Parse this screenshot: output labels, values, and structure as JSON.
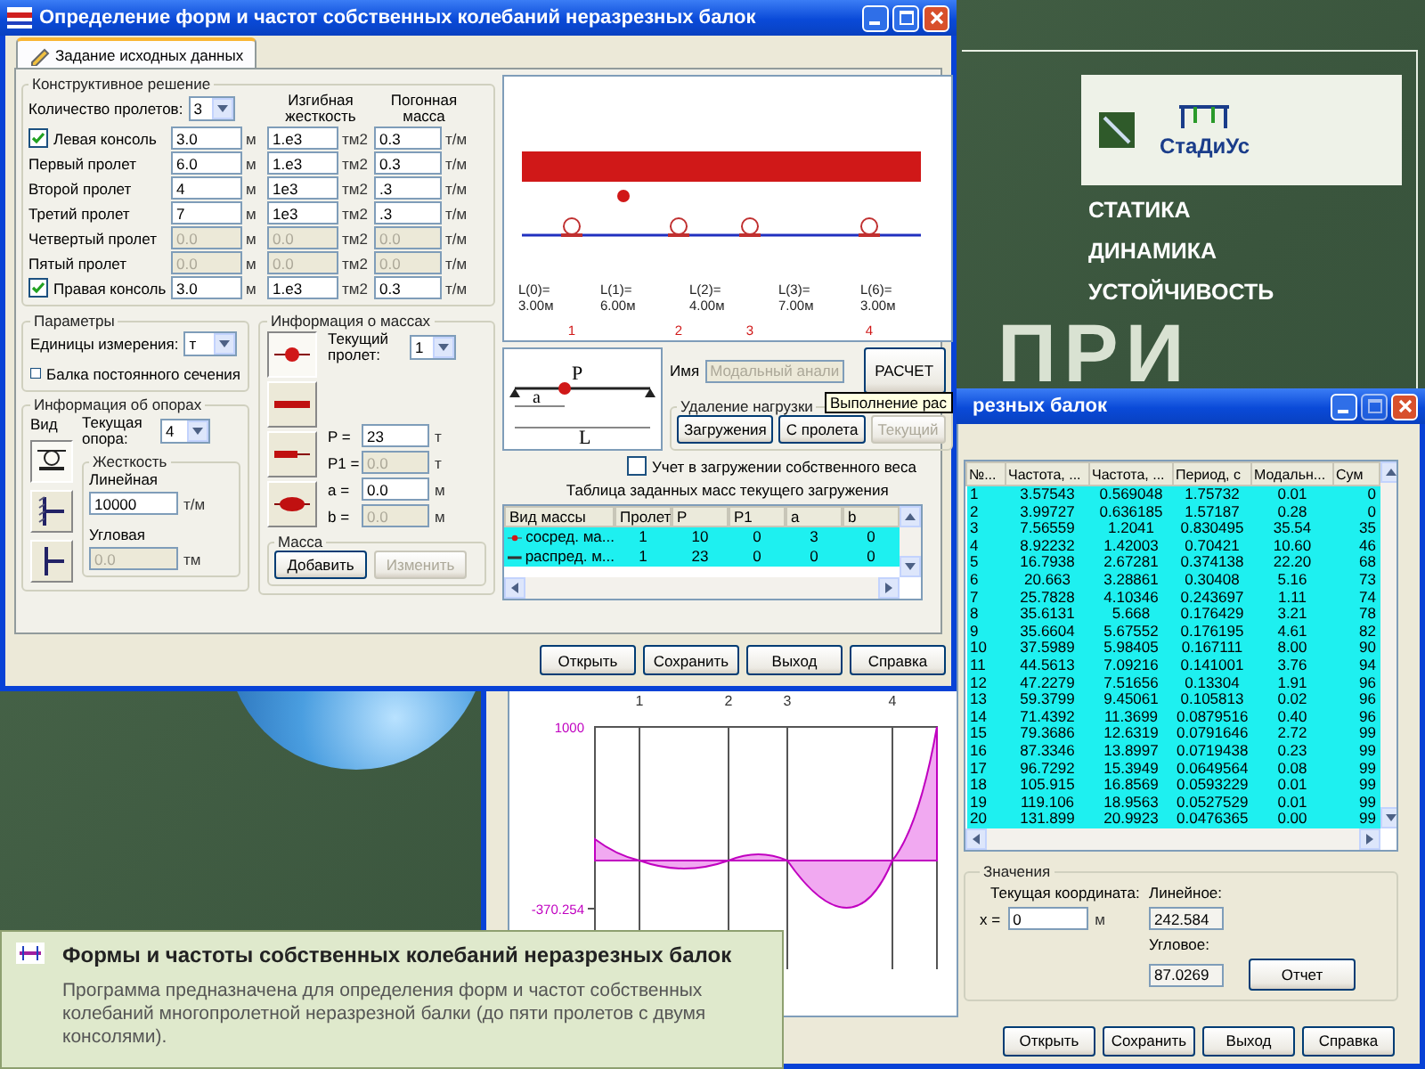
{
  "slide": {
    "background_text": "ПРИ",
    "logo": {
      "name": "СтаДиУс"
    },
    "topics": [
      "СТАТИКА",
      "ДИНАМИКА",
      "УСТОЙЧИВОСТЬ"
    ]
  },
  "main_window": {
    "title": "Определение форм и частот собственных колебаний неразрезных балок",
    "tabs": [
      {
        "label": "Задание исходных данных",
        "selected": true
      }
    ],
    "structure": {
      "title": "Конструктивное решение",
      "span_count_label": "Количество пролетов:",
      "span_count": "3",
      "headers": [
        "Изгибная жесткость",
        "Погонная масса"
      ],
      "rows": [
        {
          "label": "Левая консоль",
          "kind": "checkbox",
          "checked": true,
          "disabled": false,
          "length": "3.0",
          "length_unit": "м",
          "stiffness": "1.e3",
          "stiffness_unit": "тм2",
          "mass": "0.3",
          "mass_unit": "т/м"
        },
        {
          "label": "Первый пролет",
          "kind": "plain",
          "disabled": false,
          "length": "6.0",
          "length_unit": "м",
          "stiffness": "1.e3",
          "stiffness_unit": "тм2",
          "mass": "0.3",
          "mass_unit": "т/м"
        },
        {
          "label": "Второй пролет",
          "kind": "plain",
          "disabled": false,
          "length": "4",
          "length_unit": "м",
          "stiffness": "1e3",
          "stiffness_unit": "тм2",
          "mass": ".3",
          "mass_unit": "т/м"
        },
        {
          "label": "Третий пролет",
          "kind": "plain",
          "disabled": false,
          "length": "7",
          "length_unit": "м",
          "stiffness": "1e3",
          "stiffness_unit": "тм2",
          "mass": ".3",
          "mass_unit": "т/м"
        },
        {
          "label": "Четвертый пролет",
          "kind": "plain",
          "disabled": true,
          "length": "0.0",
          "length_unit": "м",
          "stiffness": "0.0",
          "stiffness_unit": "тм2",
          "mass": "0.0",
          "mass_unit": "т/м"
        },
        {
          "label": "Пятый пролет",
          "kind": "plain",
          "disabled": true,
          "length": "0.0",
          "length_unit": "м",
          "stiffness": "0.0",
          "stiffness_unit": "тм2",
          "mass": "0.0",
          "mass_unit": "т/м"
        },
        {
          "label": "Правая консоль",
          "kind": "checkbox",
          "checked": true,
          "disabled": false,
          "length": "3.0",
          "length_unit": "м",
          "stiffness": "1.e3",
          "stiffness_unit": "тм2",
          "mass": "0.3",
          "mass_unit": "т/м"
        }
      ]
    },
    "beam_drawing": {
      "spans": [
        {
          "label": "L(0)=",
          "value": "3.00м"
        },
        {
          "label": "L(1)=",
          "value": "6.00м"
        },
        {
          "label": "L(2)=",
          "value": "4.00м"
        },
        {
          "label": "L(3)=",
          "value": "7.00м"
        },
        {
          "label": "L(6)=",
          "value": "3.00м"
        }
      ],
      "support_numbers": [
        "1",
        "2",
        "3",
        "4"
      ]
    },
    "params": {
      "title": "Параметры",
      "units_label": "Единицы измерения:",
      "units": "т",
      "constant_section": {
        "label": "Балка постоянного сечения",
        "checked": false
      }
    },
    "supports": {
      "title": "Информация об опорах",
      "kind_label": "Вид",
      "current_label": "Текущая опора:",
      "current": "4",
      "types": [
        {
          "kind": "hinge",
          "selected": true
        },
        {
          "kind": "wall",
          "selected": false
        },
        {
          "kind": "fixed",
          "selected": false
        }
      ],
      "stiffness": {
        "title": "Жесткость",
        "linear_label": "Линейная",
        "linear": "10000",
        "linear_unit": "т/м",
        "linear_disabled": false,
        "angular_label": "Угловая",
        "angular": "0.0",
        "angular_unit": "тм",
        "angular_disabled": true
      }
    },
    "masses": {
      "title": "Информация о массах",
      "current_label": "Текущий пролет:",
      "current": "1",
      "types": [
        {
          "kind": "point",
          "selected": true
        },
        {
          "kind": "distributed",
          "selected": false
        },
        {
          "kind": "partial",
          "selected": false
        },
        {
          "kind": "lens",
          "selected": false
        }
      ],
      "fields": [
        {
          "label": "P =",
          "value": "23",
          "unit": "т",
          "disabled": false
        },
        {
          "label": "P1 =",
          "value": "0.0",
          "unit": "т",
          "disabled": true
        },
        {
          "label": "a =",
          "value": "0.0",
          "unit": "м",
          "disabled": false
        },
        {
          "label": "b =",
          "value": "0.0",
          "unit": "м",
          "disabled": true
        }
      ],
      "mass_group": {
        "title": "Масса",
        "buttons": [
          {
            "label": "Добавить",
            "disabled": false
          },
          {
            "label": "Изменить",
            "disabled": true
          }
        ]
      }
    },
    "load_diagram": {
      "force": "P",
      "offset": "a",
      "length": "L"
    },
    "name_field": {
      "label": "Имя",
      "value": "Модальный анали",
      "disabled": true
    },
    "calc_button": "РАСЧЕТ",
    "tooltip": "Выполнение рас",
    "unload": {
      "title": "Удаление нагрузки",
      "buttons": [
        {
          "label": "Загружения",
          "disabled": false
        },
        {
          "label": "С пролета",
          "disabled": false
        },
        {
          "label": "Текущий",
          "disabled": true
        }
      ]
    },
    "self_weight": {
      "label": "Учет в загружении собственного веса",
      "checked": false
    },
    "mass_table": {
      "title": "Таблица заданных масс текущего загружения",
      "columns": [
        "Вид массы",
        "Пролет",
        "P",
        "P1",
        "a",
        "b"
      ],
      "rows": [
        {
          "kind": "point",
          "selected": true,
          "cells": [
            "сосред. ма...",
            "1",
            "10",
            "0",
            "3",
            "0"
          ]
        },
        {
          "kind": "distributed",
          "selected": true,
          "cells": [
            "распред. м...",
            "1",
            "23",
            "0",
            "0",
            "0"
          ]
        }
      ]
    },
    "buttons": [
      "Открыть",
      "Сохранить",
      "Выход",
      "Справка"
    ]
  },
  "results_window": {
    "title": "резных балок",
    "chart": {
      "support_numbers": [
        "1",
        "2",
        "3",
        "4"
      ],
      "max_label": "1000",
      "min_label": "-370.254"
    },
    "table": {
      "columns": [
        "№...",
        "Частота, ...",
        "Частота, ...",
        "Период, с",
        "Модальн...",
        "Сум"
      ],
      "rows": [
        {
          "selected": true,
          "cells": [
            "1",
            "3.57543",
            "0.569048",
            "1.75732",
            "0.01",
            "0"
          ]
        },
        {
          "selected": true,
          "cells": [
            "2",
            "3.99727",
            "0.636185",
            "1.57187",
            "0.28",
            "0"
          ]
        },
        {
          "selected": true,
          "cells": [
            "3",
            "7.56559",
            "1.2041",
            "0.830495",
            "35.54",
            "35"
          ]
        },
        {
          "selected": true,
          "cells": [
            "4",
            "8.92232",
            "1.42003",
            "0.70421",
            "10.60",
            "46"
          ]
        },
        {
          "selected": true,
          "cells": [
            "5",
            "16.7938",
            "2.67281",
            "0.374138",
            "22.20",
            "68"
          ]
        },
        {
          "selected": true,
          "cells": [
            "6",
            "20.663",
            "3.28861",
            "0.30408",
            "5.16",
            "73"
          ]
        },
        {
          "selected": true,
          "cells": [
            "7",
            "25.7828",
            "4.10346",
            "0.243697",
            "1.11",
            "74"
          ]
        },
        {
          "selected": true,
          "cells": [
            "8",
            "35.6131",
            "5.668",
            "0.176429",
            "3.21",
            "78"
          ]
        },
        {
          "selected": true,
          "cells": [
            "9",
            "35.6604",
            "5.67552",
            "0.176195",
            "4.61",
            "82"
          ]
        },
        {
          "selected": true,
          "cells": [
            "10",
            "37.5989",
            "5.98405",
            "0.167111",
            "8.00",
            "90"
          ]
        },
        {
          "selected": true,
          "cells": [
            "11",
            "44.5613",
            "7.09216",
            "0.141001",
            "3.76",
            "94"
          ]
        },
        {
          "selected": true,
          "cells": [
            "12",
            "47.2279",
            "7.51656",
            "0.13304",
            "1.91",
            "96"
          ]
        },
        {
          "selected": true,
          "cells": [
            "13",
            "59.3799",
            "9.45061",
            "0.105813",
            "0.02",
            "96"
          ]
        },
        {
          "selected": true,
          "cells": [
            "14",
            "71.4392",
            "11.3699",
            "0.0879516",
            "0.40",
            "96"
          ]
        },
        {
          "selected": true,
          "cells": [
            "15",
            "79.3686",
            "12.6319",
            "0.0791646",
            "2.72",
            "99"
          ]
        },
        {
          "selected": true,
          "cells": [
            "16",
            "87.3346",
            "13.8997",
            "0.0719438",
            "0.23",
            "99"
          ]
        },
        {
          "selected": true,
          "cells": [
            "17",
            "96.7292",
            "15.3949",
            "0.0649564",
            "0.08",
            "99"
          ]
        },
        {
          "selected": true,
          "cells": [
            "18",
            "105.915",
            "16.8569",
            "0.0593229",
            "0.01",
            "99"
          ]
        },
        {
          "selected": true,
          "cells": [
            "19",
            "119.106",
            "18.9563",
            "0.0527529",
            "0.01",
            "99"
          ]
        },
        {
          "selected": true,
          "cells": [
            "20",
            "131.899",
            "20.9923",
            "0.0476365",
            "0.00",
            "99"
          ]
        }
      ]
    },
    "values": {
      "title": "Значения",
      "coord_label": "Текущая координата:",
      "x_label": "x =",
      "x_value": "0",
      "x_unit": "м",
      "linear_label": "Линейное:",
      "linear": "242.584",
      "angular_label": "Угловое:",
      "angular": "87.0269"
    },
    "report_button": "Отчет",
    "buttons": [
      "Открыть",
      "Сохранить",
      "Выход",
      "Справка"
    ]
  },
  "caption": {
    "title": "Формы и частоты собственных колебаний неразрезных балок",
    "text": "Программа предназначена для определения форм и частот собственных колебаний многопролетной неразрезной балки (до пяти пролетов с двумя консолями)."
  }
}
